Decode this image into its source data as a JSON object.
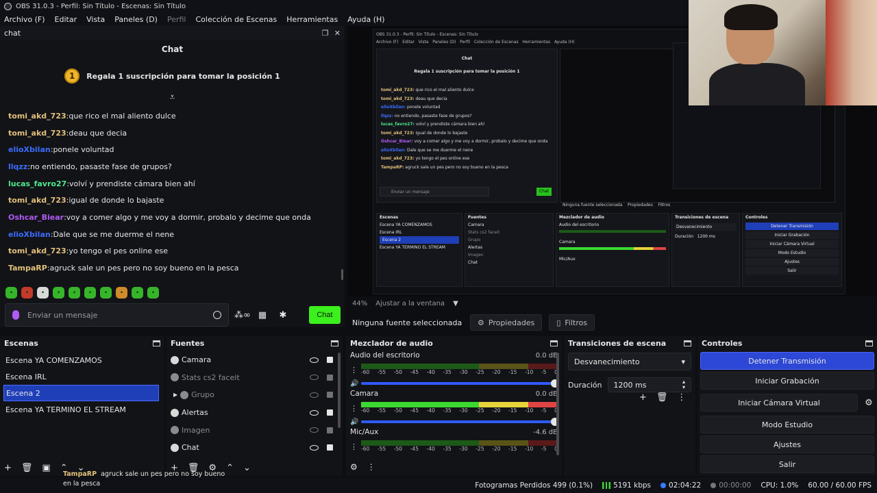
{
  "window": {
    "title": "OBS 31.0.3 - Perfil: Sin Título - Escenas: Sin Título"
  },
  "menu": [
    {
      "label": "Archivo (F)",
      "disabled": false
    },
    {
      "label": "Editar",
      "disabled": false
    },
    {
      "label": "Vista",
      "disabled": false
    },
    {
      "label": "Paneles (D)",
      "disabled": false
    },
    {
      "label": "Perfil",
      "disabled": true
    },
    {
      "label": "Colección de Escenas",
      "disabled": false
    },
    {
      "label": "Herramientas",
      "disabled": false
    },
    {
      "label": "Ayuda (H)",
      "disabled": false
    }
  ],
  "chat_dock": {
    "dock_title": "chat",
    "title": "Chat",
    "banner_rank": "1",
    "banner_text": "Regala 1 suscripción para tomar la posición 1",
    "messages": [
      {
        "user": "tomi_akd_723",
        "color": "#e2c07a",
        "text": "que rico el mal aliento dulce"
      },
      {
        "user": "tomi_akd_723",
        "color": "#e2c07a",
        "text": "deau que decia"
      },
      {
        "user": "elioXbilan",
        "color": "#3b6cff",
        "text": "ponele voluntad"
      },
      {
        "user": "llqzz",
        "color": "#3b6cff",
        "text": "no entiendo, pasaste fase de grupos?"
      },
      {
        "user": "lucas_favro27",
        "color": "#4de88a",
        "text": "volví y prendiste cámara bien ahí"
      },
      {
        "user": "tomi_akd_723",
        "color": "#e2c07a",
        "text": "igual de donde lo bajaste"
      },
      {
        "user": "Oshcar_Biear",
        "color": "#b15bf5",
        "text": "voy a comer algo y me voy a dormir, probalo y decime que onda"
      },
      {
        "user": "elioXbilan",
        "color": "#3b6cff",
        "text": "Dale que se me duerme el nene"
      },
      {
        "user": "tomi_akd_723",
        "color": "#e2c07a",
        "text": "yo tengo el pes online ese"
      },
      {
        "user": "TampaRP",
        "color": "#e2c07a",
        "text": "agruck sale un pes pero no soy bueno en la pesca"
      }
    ],
    "input_placeholder": "Enviar un mensaje",
    "send_label": "Chat"
  },
  "preview": {
    "zoom": "44%",
    "fit_label": "Ajustar a la ventana"
  },
  "source_toolbar": {
    "no_selection": "Ninguna fuente seleccionada",
    "properties": "Propiedades",
    "filters": "Filtros"
  },
  "scenes": {
    "title": "Escenas",
    "items": [
      {
        "label": "Escena YA COMENZAMOS",
        "selected": false
      },
      {
        "label": "Escena IRL",
        "selected": false
      },
      {
        "label": "Escena 2",
        "selected": true
      },
      {
        "label": "Escena YA TERMINO EL STREAM",
        "selected": false
      }
    ]
  },
  "sources": {
    "title": "Fuentes",
    "items": [
      {
        "label": "Camara",
        "visible": true,
        "group": false
      },
      {
        "label": "Stats cs2 faceit",
        "visible": false,
        "group": false
      },
      {
        "label": "Grupo",
        "visible": false,
        "group": true
      },
      {
        "label": "Alertas",
        "visible": true,
        "group": false
      },
      {
        "label": "Imagen",
        "visible": false,
        "group": false
      },
      {
        "label": "Chat",
        "visible": true,
        "group": false
      }
    ]
  },
  "mixer": {
    "title": "Mezclador de audio",
    "scale": [
      "-60",
      "-55",
      "-50",
      "-45",
      "-40",
      "-35",
      "-30",
      "-25",
      "-20",
      "-15",
      "-10",
      "-5",
      "0"
    ],
    "channels": [
      {
        "name": "Audio del escritorio",
        "db": "0.0 dB",
        "active": false
      },
      {
        "name": "Camara",
        "db": "0.0 dB",
        "active": true
      },
      {
        "name": "Mic/Aux",
        "db": "-4.6 dB",
        "active": false
      }
    ]
  },
  "transitions": {
    "title": "Transiciones de escena",
    "selected": "Desvanecimiento",
    "duration_label": "Duración",
    "duration_value": "1200 ms"
  },
  "controls": {
    "title": "Controles",
    "stop_stream": "Detener Transmisión",
    "start_record": "Iniciar Grabación",
    "virtual_cam": "Iniciar Cámara Virtual",
    "studio_mode": "Modo Estudio",
    "settings": "Ajustes",
    "exit": "Salir"
  },
  "status": {
    "dropped_frames": "Fotogramas Perdidos 499 (0.1%)",
    "bitrate": "5191 kbps",
    "live_time": "02:04:22",
    "rec_time": "00:00:00",
    "cpu": "CPU: 1.0%",
    "fps": "60.00 / 60.00 FPS"
  },
  "overlay": {
    "user": "TampaRP",
    "text": "agruck sale un pes pero no soy bueno en la pesca"
  },
  "colors": {
    "accent_blue": "#2d47d6",
    "chat_send_green": "#3cf01d",
    "meter_green": "#3cd832"
  }
}
